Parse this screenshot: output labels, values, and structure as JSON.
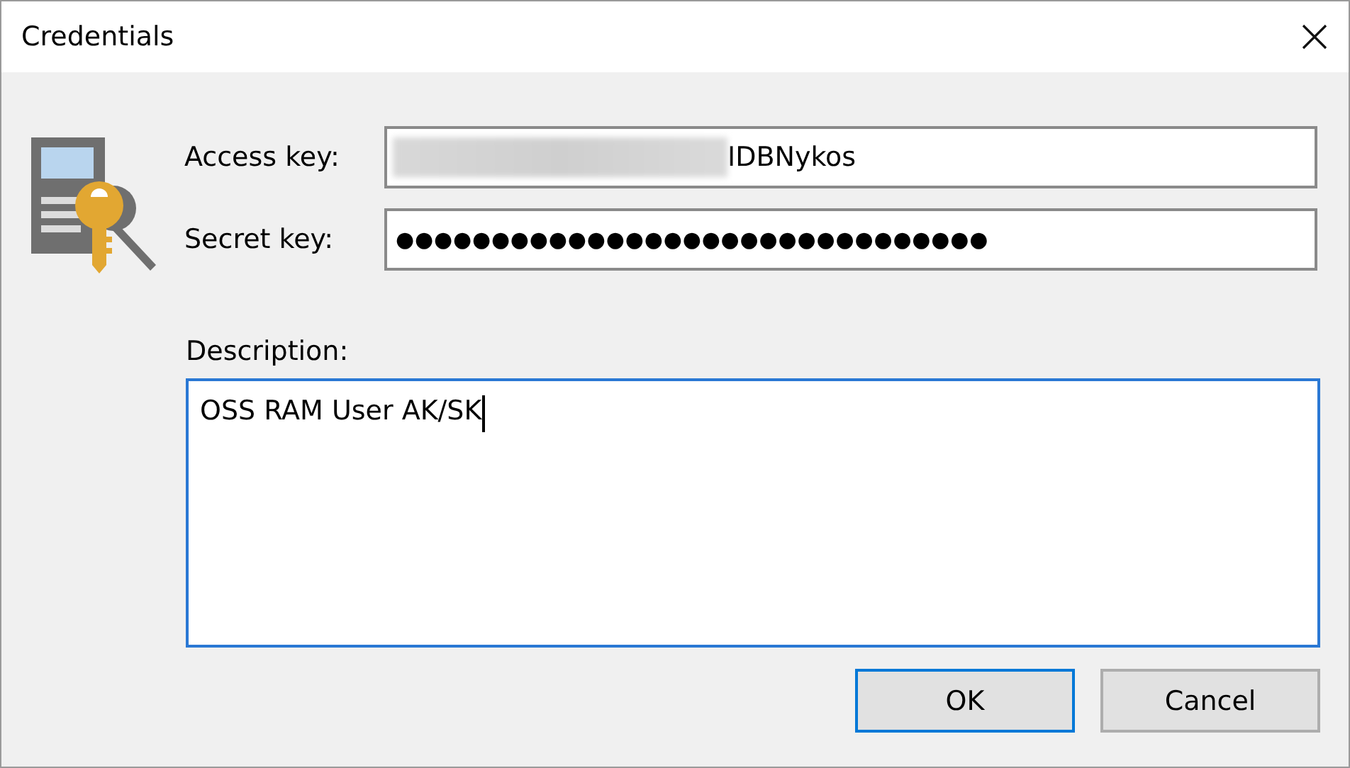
{
  "window": {
    "title": "Credentials"
  },
  "fields": [
    {
      "label": "Access key:",
      "value": "IDBNykos",
      "blurred_prefix": true,
      "kind": "text"
    },
    {
      "label": "Secret key:",
      "value": "●●●●●●●●●●●●●●●●●●●●●●●●●●●●●●●",
      "blurred_prefix": false,
      "kind": "password"
    }
  ],
  "description": {
    "label": "Description:",
    "value": "OSS RAM User AK/SK",
    "focused": true
  },
  "buttons": [
    {
      "label": "OK",
      "default": true
    },
    {
      "label": "Cancel",
      "default": false
    }
  ]
}
